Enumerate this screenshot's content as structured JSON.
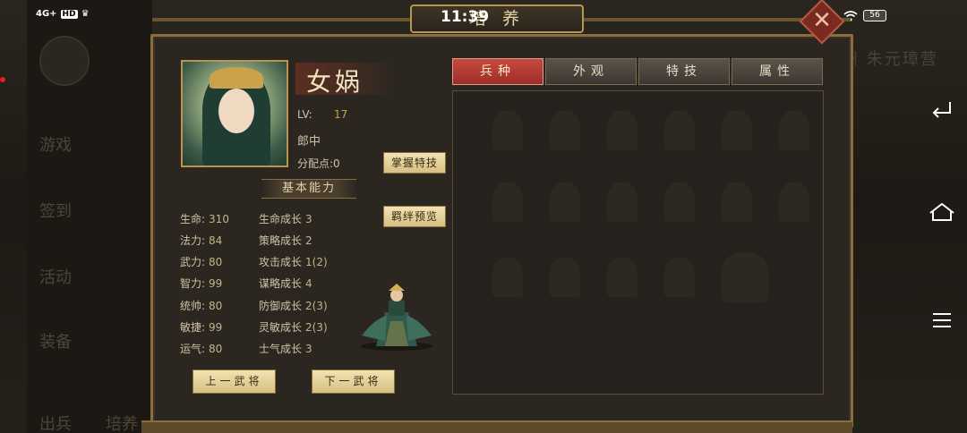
{
  "status_bar": {
    "network": "4G+",
    "hd": "HD",
    "time": "11:39",
    "battery": "56"
  },
  "window": {
    "title": "培 养",
    "close_icon": "close-icon"
  },
  "background": {
    "left_menu": [
      "游戏",
      "签到",
      "活动",
      "装备",
      "出兵",
      "培养"
    ],
    "right_text": "州 朱元璋营"
  },
  "hero": {
    "name": "女娲",
    "lv_label": "LV:",
    "lv_value": "17",
    "rank": "郎中",
    "points_label": "分配点:",
    "points_value": "0",
    "master_skill_button": "掌握特技",
    "bond_preview_button": "羁绊预览",
    "section_title": "基本能力"
  },
  "base_stats": [
    {
      "label": "生命:",
      "value": "310"
    },
    {
      "label": "法力:",
      "value": "84"
    },
    {
      "label": "武力:",
      "value": "80"
    },
    {
      "label": "智力:",
      "value": "99"
    },
    {
      "label": "统帅:",
      "value": "80"
    },
    {
      "label": "敏捷:",
      "value": "99"
    },
    {
      "label": "运气:",
      "value": "80"
    }
  ],
  "growth_stats": [
    {
      "label": "生命成长",
      "value": "3"
    },
    {
      "label": "策略成长",
      "value": "2"
    },
    {
      "label": "攻击成长",
      "value": "1(2)"
    },
    {
      "label": "谋略成长",
      "value": "4"
    },
    {
      "label": "防御成长",
      "value": "2(3)"
    },
    {
      "label": "灵敏成长",
      "value": "2(3)"
    },
    {
      "label": "士气成长",
      "value": "3"
    }
  ],
  "nav_buttons": {
    "prev": "上一武将",
    "next": "下一武将"
  },
  "tabs": [
    {
      "label": "兵种",
      "active": true
    },
    {
      "label": "外观",
      "active": false
    },
    {
      "label": "特技",
      "active": false
    },
    {
      "label": "属性",
      "active": false
    }
  ],
  "system_nav": {
    "back_icon": "back-icon",
    "home_icon": "home-icon",
    "menu_icon": "menu-icon"
  }
}
